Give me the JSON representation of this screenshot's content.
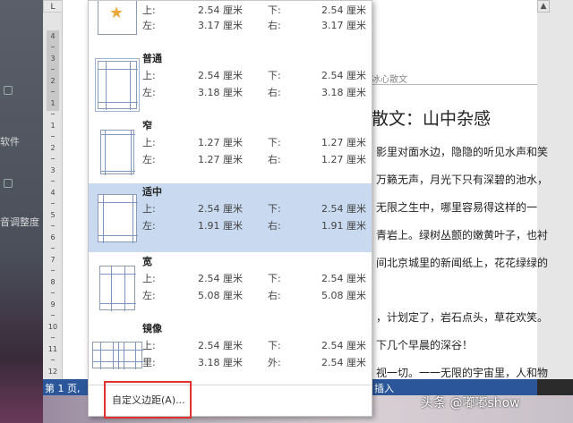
{
  "ruler": {
    "corner": "L",
    "numbers": [
      "4",
      "3",
      "2",
      "1",
      "1",
      "2",
      "3",
      "4",
      "5",
      "6",
      "7",
      "8",
      "9",
      "10",
      "11",
      "12"
    ]
  },
  "background": {
    "texts": [
      "软件",
      "音调整度"
    ]
  },
  "document": {
    "header": "冰心散文",
    "title": "散文：山中杂感",
    "lines": [
      "影里对面水边，隐隐的听见水声和笑",
      "万籁无声，月光下只有深碧的池水，",
      "无限之生中，哪里容易得这样的一",
      "青岩上。绿树丛颤的嫩黄叶子，也衬",
      "间北京城里的新闻纸上，花花绿绿的",
      "，计划定了，岩石点头，草花欢笑。",
      "下几个早晨的深谷！",
      "视一切。一一无限的宇宙里，人和物"
    ]
  },
  "status_bar": {
    "page": "第 1 页,",
    "insert": "插入"
  },
  "watermark": "头条 @嘟嘟show",
  "margins_menu": {
    "presets": [
      {
        "name": "",
        "top_label": "上:",
        "top": "2.54 厘米",
        "bottom_label": "下:",
        "bottom": "2.54 厘米",
        "left_label": "左:",
        "left": "3.17 厘米",
        "right_label": "右:",
        "right": "3.17 厘米"
      },
      {
        "name": "普通",
        "top_label": "上:",
        "top": "2.54 厘米",
        "bottom_label": "下:",
        "bottom": "2.54 厘米",
        "left_label": "左:",
        "left": "3.18 厘米",
        "right_label": "右:",
        "right": "3.18 厘米"
      },
      {
        "name": "窄",
        "top_label": "上:",
        "top": "1.27 厘米",
        "bottom_label": "下:",
        "bottom": "1.27 厘米",
        "left_label": "左:",
        "left": "1.27 厘米",
        "right_label": "右:",
        "right": "1.27 厘米"
      },
      {
        "name": "适中",
        "top_label": "上:",
        "top": "2.54 厘米",
        "bottom_label": "下:",
        "bottom": "2.54 厘米",
        "left_label": "左:",
        "left": "1.91 厘米",
        "right_label": "右:",
        "right": "1.91 厘米"
      },
      {
        "name": "宽",
        "top_label": "上:",
        "top": "2.54 厘米",
        "bottom_label": "下:",
        "bottom": "2.54 厘米",
        "left_label": "左:",
        "left": "5.08 厘米",
        "right_label": "右:",
        "right": "5.08 厘米"
      },
      {
        "name": "镜像",
        "top_label": "上:",
        "top": "2.54 厘米",
        "bottom_label": "下:",
        "bottom": "2.54 厘米",
        "left_label": "里:",
        "left": "3.18 厘米",
        "right_label": "外:",
        "right": "2.54 厘米"
      }
    ],
    "selected": "适中",
    "custom_label": "自定义边距(A)..."
  },
  "colors": {
    "status_bar": "#2b579a",
    "selected_row": "#c9daf0",
    "highlight_box": "#e0302f"
  }
}
